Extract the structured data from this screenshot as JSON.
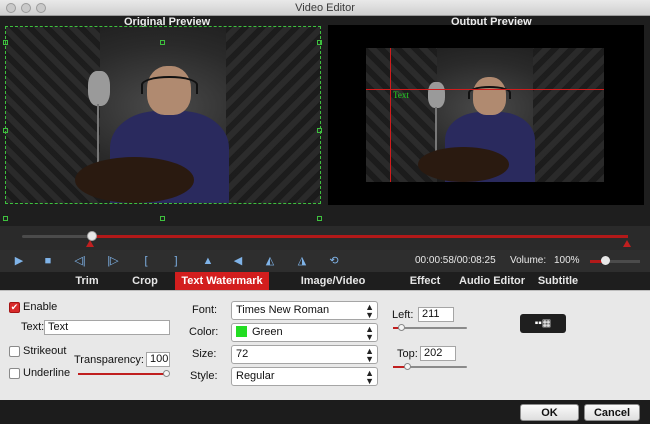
{
  "window": {
    "title": "Video Editor"
  },
  "preview": {
    "original_label": "Original Preview",
    "output_label": "Output Preview",
    "watermark_text": "Text"
  },
  "playback": {
    "time": "00:00:58/00:08:25",
    "volume_label": "Volume:",
    "volume_value": "100%",
    "progress_fraction": 0.115
  },
  "tabs": [
    {
      "label": "Trim",
      "active": false
    },
    {
      "label": "Crop",
      "active": false
    },
    {
      "label": "Text Watermark",
      "active": true
    },
    {
      "label": "Image/Video Watermark",
      "active": false
    },
    {
      "label": "Effect",
      "active": false
    },
    {
      "label": "Audio Editor",
      "active": false
    },
    {
      "label": "Subtitle",
      "active": false
    }
  ],
  "watermark": {
    "enable_label": "Enable",
    "enable_checked": true,
    "text_label": "Text:",
    "text_value": "Text",
    "strikeout_label": "Strikeout",
    "underline_label": "Underline",
    "transparency_label": "Transparency:",
    "transparency_value": "100",
    "font_label": "Font:",
    "font_value": "Times New Roman",
    "color_label": "Color:",
    "color_value": "Green",
    "color_hex": "#22dd22",
    "size_label": "Size:",
    "size_value": "72",
    "style_label": "Style:",
    "style_value": "Regular",
    "left_label": "Left:",
    "left_value": "211",
    "top_label": "Top:",
    "top_value": "202"
  },
  "buttons": {
    "ok": "OK",
    "cancel": "Cancel"
  },
  "colors": {
    "accent": "#d31e1e",
    "selection": "#3ec13e"
  }
}
